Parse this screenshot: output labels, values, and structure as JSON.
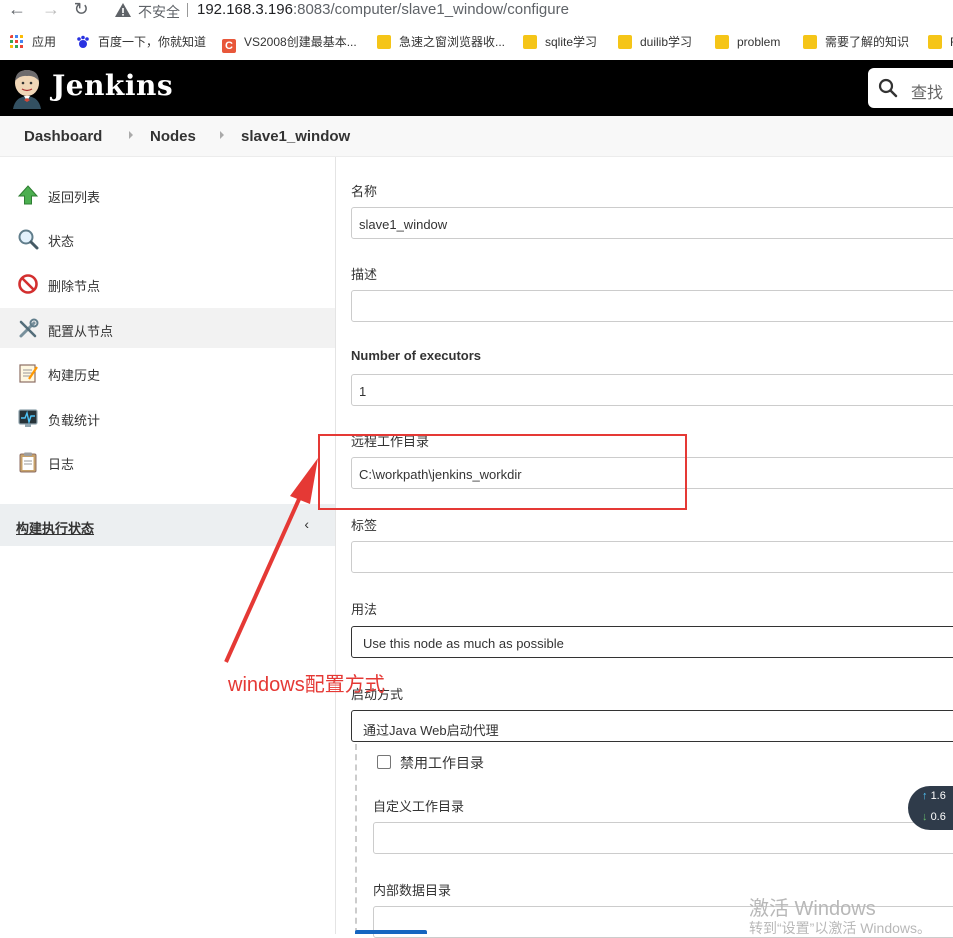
{
  "browser": {
    "security_label": "不安全",
    "url_host": "192.168.3.196",
    "url_rest": ":8083/computer/slave1_window/configure"
  },
  "bookmarks": [
    {
      "label": "应用",
      "icon": "apps-grid-icon"
    },
    {
      "label": "百度一下，你就知道",
      "icon": "baidu-paw-icon"
    },
    {
      "label": "VS2008创建最基本...",
      "icon": "csdn-icon"
    },
    {
      "label": "急速之窗浏览器收...",
      "icon": "folder-icon"
    },
    {
      "label": "sqlite学习",
      "icon": "folder-icon"
    },
    {
      "label": "duilib学习",
      "icon": "folder-icon"
    },
    {
      "label": "problem",
      "icon": "folder-icon"
    },
    {
      "label": "需要了解的知识",
      "icon": "folder-icon"
    },
    {
      "label": "R",
      "icon": "folder-icon"
    }
  ],
  "header": {
    "brand": "Jenkins",
    "search_placeholder": "查找"
  },
  "breadcrumb": [
    "Dashboard",
    "Nodes",
    "slave1_window"
  ],
  "sidebar": {
    "items": [
      {
        "label": "返回列表",
        "icon": "up-arrow-icon"
      },
      {
        "label": "状态",
        "icon": "magnifier-icon"
      },
      {
        "label": "删除节点",
        "icon": "no-entry-icon"
      },
      {
        "label": "配置从节点",
        "icon": "tools-icon"
      },
      {
        "label": "构建历史",
        "icon": "notepad-icon"
      },
      {
        "label": "负载统计",
        "icon": "monitor-icon"
      },
      {
        "label": "日志",
        "icon": "clipboard-icon"
      }
    ],
    "executor_status": "构建执行状态",
    "collapse": "‹"
  },
  "form": {
    "name_label": "名称",
    "name_value": "slave1_window",
    "desc_label": "描述",
    "desc_value": "",
    "executors_label": "Number of executors",
    "executors_value": "1",
    "remote_dir_label": "远程工作目录",
    "remote_dir_value": "C:\\workpath\\jenkins_workdir",
    "labels_label": "标签",
    "labels_value": "",
    "usage_label": "用法",
    "usage_value": "Use this node as much as possible",
    "launch_label": "启动方式",
    "launch_value": "通过Java Web启动代理",
    "disable_workdir_label": "禁用工作目录",
    "custom_workdir_label": "自定义工作目录",
    "internal_data_label": "内部数据目录"
  },
  "annotation": {
    "text": "windows配置方式",
    "color": "#e53935"
  },
  "net_speed": {
    "up": "1.6",
    "down": "0.6"
  },
  "watermark": {
    "line1": "激活 Windows",
    "line2": "转到“设置”以激活 Windows。"
  }
}
